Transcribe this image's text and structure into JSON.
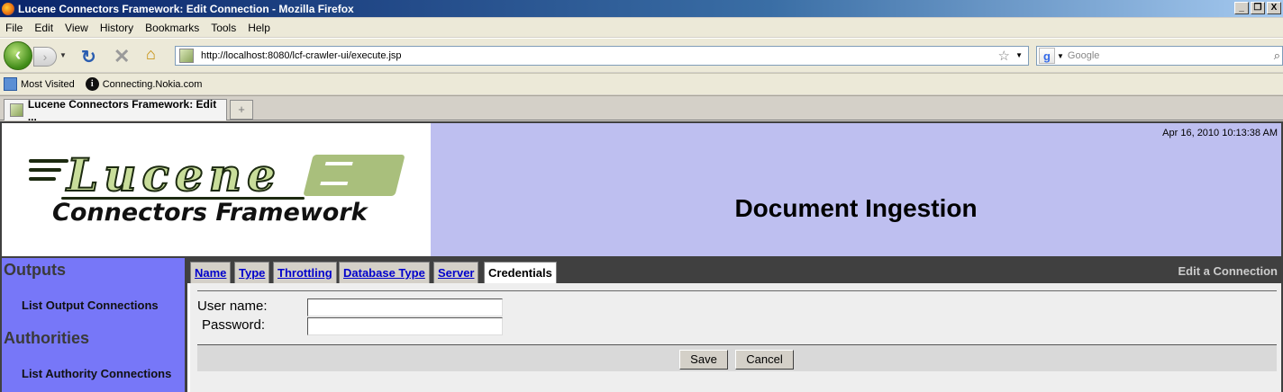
{
  "window": {
    "title": "Lucene Connectors Framework: Edit Connection - Mozilla Firefox",
    "min": "_",
    "restore": "❐",
    "close": "X"
  },
  "menubar": {
    "items": [
      "File",
      "Edit",
      "View",
      "History",
      "Bookmarks",
      "Tools",
      "Help"
    ]
  },
  "navbar": {
    "url": "http://localhost:8080/lcf-crawler-ui/execute.jsp",
    "search_placeholder": "Google",
    "search_engine": "g"
  },
  "bookmarks": {
    "items": [
      {
        "label": "Most Visited",
        "icon": "folder-icon"
      },
      {
        "label": "Connecting.Nokia.com",
        "icon": "info-icon"
      }
    ]
  },
  "browser_tabs": [
    {
      "label": "Lucene Connectors Framework: Edit ..."
    }
  ],
  "page": {
    "logo": {
      "word": "Lucene",
      "subtitle": "Connectors Framework"
    },
    "timestamp": "Apr 16, 2010 10:13:38 AM",
    "title": "Document Ingestion",
    "sidebar": {
      "sections": [
        {
          "heading": "Outputs",
          "link": "List Output Connections"
        },
        {
          "heading": "Authorities",
          "link": "List Authority Connections"
        }
      ]
    },
    "tabs": [
      "Name",
      "Type",
      "Throttling",
      "Database Type",
      "Server",
      "Credentials"
    ],
    "active_tab": "Credentials",
    "section_title": "Edit a Connection",
    "form": {
      "username_label": "User name:",
      "password_label": "Password:",
      "username_value": "",
      "password_value": ""
    },
    "buttons": {
      "save": "Save",
      "cancel": "Cancel"
    }
  },
  "colors": {
    "banner": "#bebff0",
    "sidebar": "#7777f8",
    "tabbar": "#404040",
    "logo_green": "#c8dd9a"
  }
}
